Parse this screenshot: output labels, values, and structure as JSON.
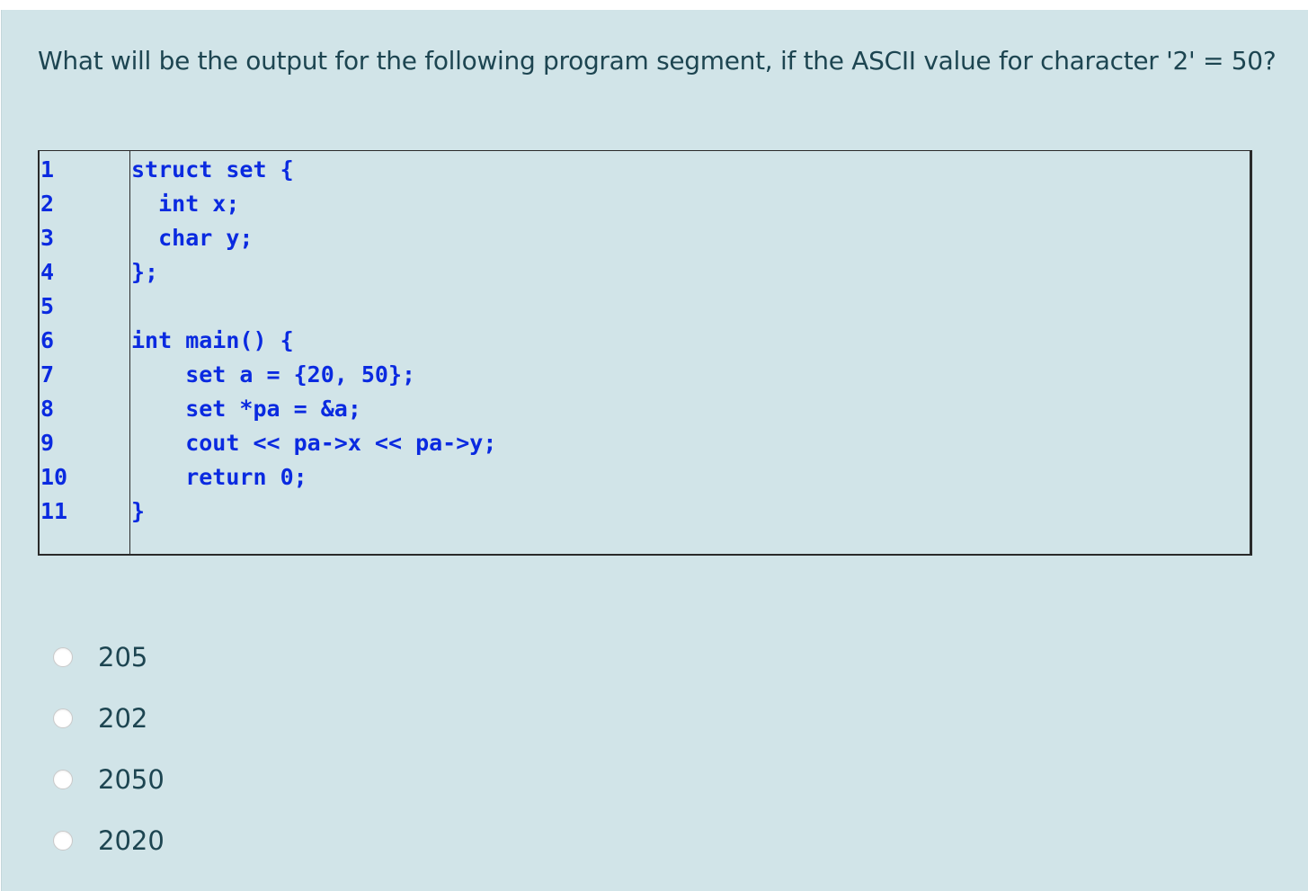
{
  "question": {
    "text": "What will be the output for the following program segment, if the ASCII value for character '2' = 50?"
  },
  "code": {
    "lines": [
      {
        "number": "1",
        "text": "struct set {"
      },
      {
        "number": "2",
        "text": "  int x;"
      },
      {
        "number": "3",
        "text": "  char y;"
      },
      {
        "number": "4",
        "text": "};"
      },
      {
        "number": "5",
        "text": ""
      },
      {
        "number": "6",
        "text": "int main() {"
      },
      {
        "number": "7",
        "text": "    set a = {20, 50};"
      },
      {
        "number": "8",
        "text": "    set *pa = &a;"
      },
      {
        "number": "9",
        "text": "    cout << pa->x << pa->y;"
      },
      {
        "number": "10",
        "text": "    return 0;"
      },
      {
        "number": "11",
        "text": "}"
      }
    ]
  },
  "options": [
    {
      "label": "205",
      "selected": false
    },
    {
      "label": "202",
      "selected": false
    },
    {
      "label": "2050",
      "selected": false
    },
    {
      "label": "2020",
      "selected": false
    }
  ],
  "colors": {
    "panel_bg": "#d1e4e8",
    "text": "#1d4551",
    "code": "#0a2ae0"
  }
}
